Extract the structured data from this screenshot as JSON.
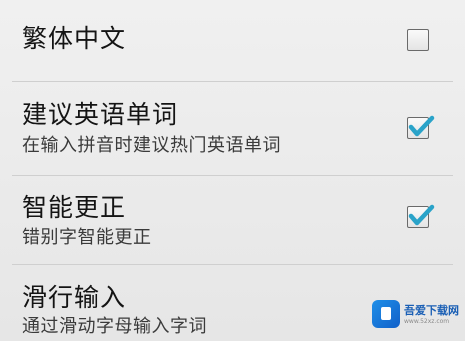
{
  "settings": [
    {
      "title": "繁体中文",
      "subtitle": "",
      "checked": false
    },
    {
      "title": "建议英语单词",
      "subtitle": "在输入拼音时建议热门英语单词",
      "checked": true
    },
    {
      "title": "智能更正",
      "subtitle": "错别字智能更正",
      "checked": true
    },
    {
      "title": "滑行输入",
      "subtitle": "通过滑动字母输入字词",
      "checked": null
    }
  ],
  "watermark": {
    "name": "吾爱下载网",
    "url": "www.52xz.com"
  },
  "colors": {
    "check_mark": "#2aa3c9",
    "divider": "#cfcfcf"
  }
}
